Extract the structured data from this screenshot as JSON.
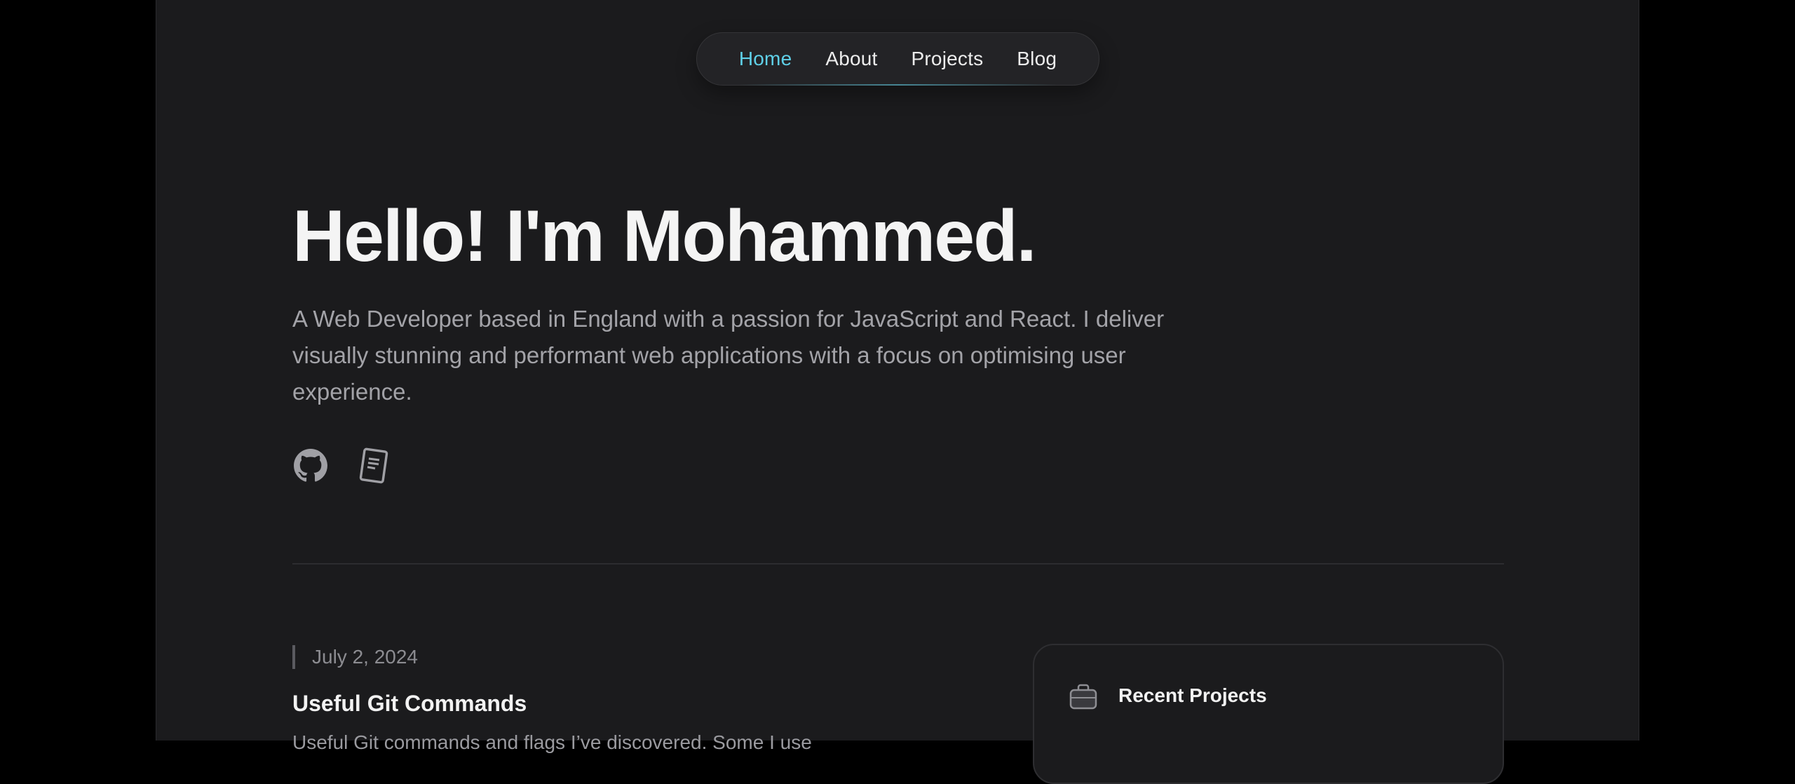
{
  "nav": {
    "items": [
      {
        "label": "Home",
        "active": true
      },
      {
        "label": "About",
        "active": false
      },
      {
        "label": "Projects",
        "active": false
      },
      {
        "label": "Blog",
        "active": false
      }
    ]
  },
  "hero": {
    "title": "Hello! I'm Mohammed.",
    "description": "A Web Developer based in England with a passion for JavaScript and React. I deliver visually stunning and performant web applications with a focus on optimising user experience.",
    "social": [
      {
        "icon": "github-icon"
      },
      {
        "icon": "resume-icon"
      }
    ]
  },
  "latest_post": {
    "date": "July 2, 2024",
    "title": "Useful Git Commands",
    "excerpt": "Useful Git commands and flags I’ve discovered. Some I use"
  },
  "recent_projects": {
    "title": "Recent Projects",
    "icon": "briefcase-icon"
  },
  "colors": {
    "accent": "#5fd0e8",
    "background": "#1b1b1d",
    "outer": "#000000"
  }
}
